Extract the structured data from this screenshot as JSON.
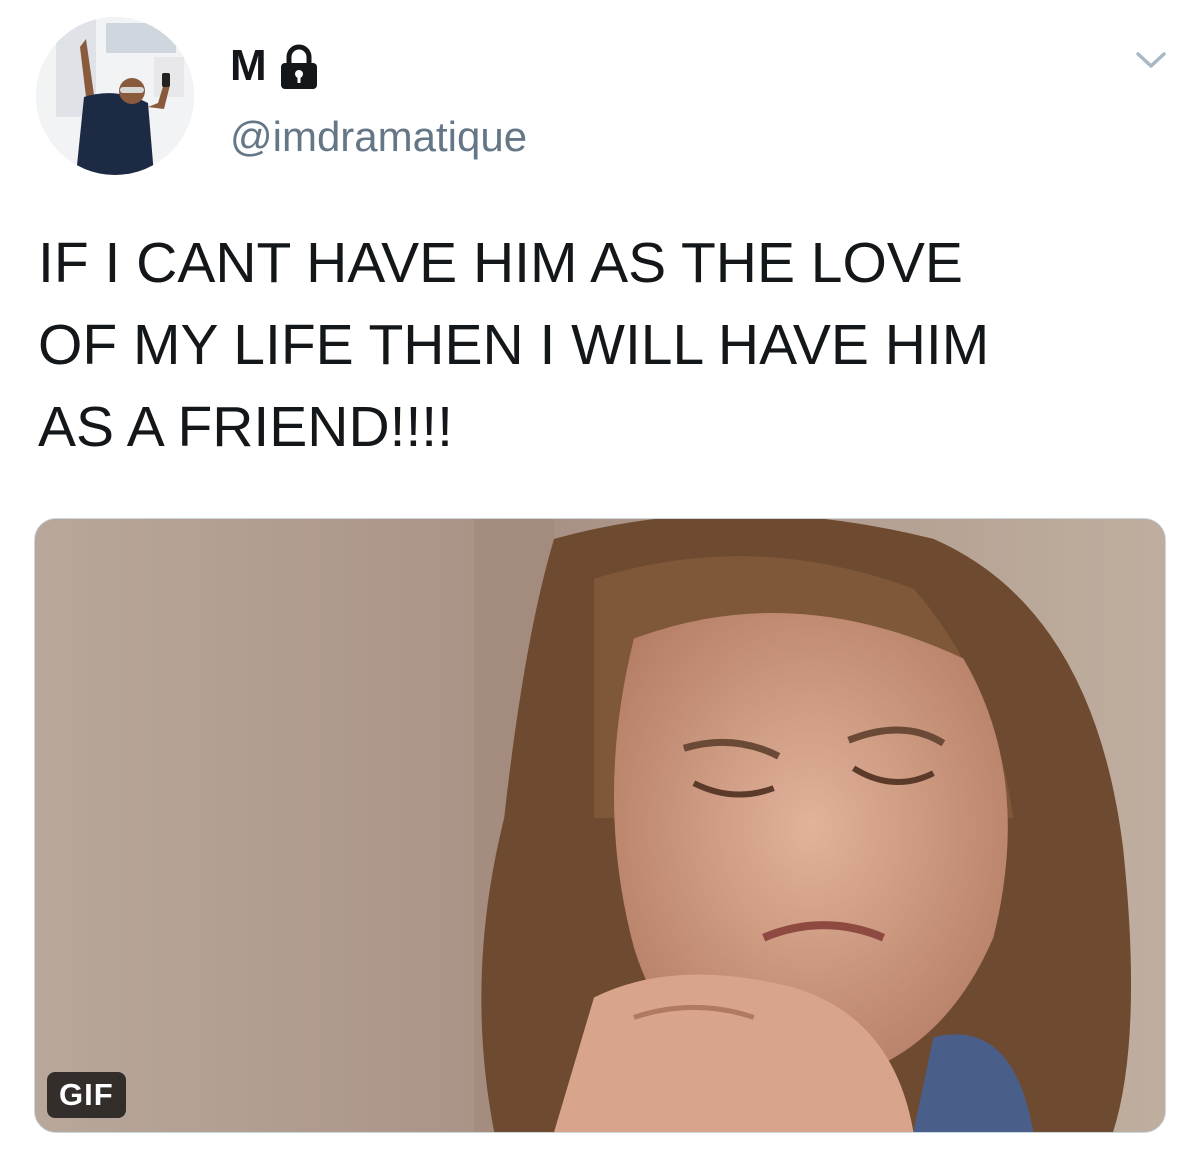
{
  "author": {
    "display_name": "M",
    "handle": "@imdramatique",
    "protected_icon": "lock-icon",
    "avatar_icon": "avatar-photo"
  },
  "menu": {
    "icon": "chevron-down-icon"
  },
  "tweet": {
    "text": "IF I CANT HAVE HIM AS THE LOVE\nOF MY LIFE THEN I WILL HAVE HIM\nAS A FRIEND!!!!"
  },
  "media": {
    "badge_label": "GIF",
    "type": "animated-gif"
  },
  "colors": {
    "text_primary": "#14171a",
    "text_secondary": "#657786",
    "badge_background": "#000000",
    "border": "#ccd6dd"
  }
}
